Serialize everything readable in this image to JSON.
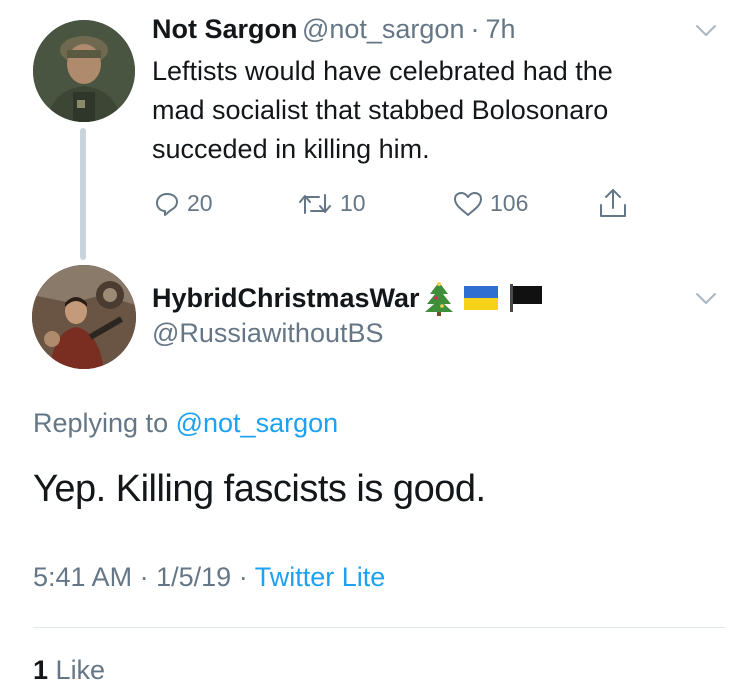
{
  "parent_tweet": {
    "display_name": "Not Sargon",
    "handle": "@not_sargon",
    "separator": "·",
    "time": "7h",
    "text_lines": [
      "Leftists would have celebrated had the",
      "mad socialist that stabbed Bolosonaro",
      "succeded in killing him."
    ],
    "actions": {
      "reply_icon": "reply-icon",
      "reply_count": "20",
      "retweet_icon": "retweet-icon",
      "retweet_count": "10",
      "like_icon": "heart-icon",
      "like_count": "106",
      "share_icon": "share-icon"
    }
  },
  "reply_tweet": {
    "display_name": "HybridChristmasWar",
    "name_emojis": [
      "christmas-tree-emoji",
      "ukraine-flag-emoji",
      "black-flag-emoji"
    ],
    "handle": "@RussiawithoutBS",
    "replying_prefix": "Replying to",
    "replying_to": "@not_sargon",
    "text": "Yep. Killing fascists is good.",
    "time": "5:41 AM",
    "date": "1/5/19",
    "separator": "·",
    "source": "Twitter Lite",
    "like_count": "1",
    "like_label": "Like"
  },
  "colors": {
    "text": "#14171a",
    "secondary": "#657786",
    "link": "#1da1f2",
    "thread_line": "#c9d3dc",
    "divider": "#e1e8ed"
  }
}
